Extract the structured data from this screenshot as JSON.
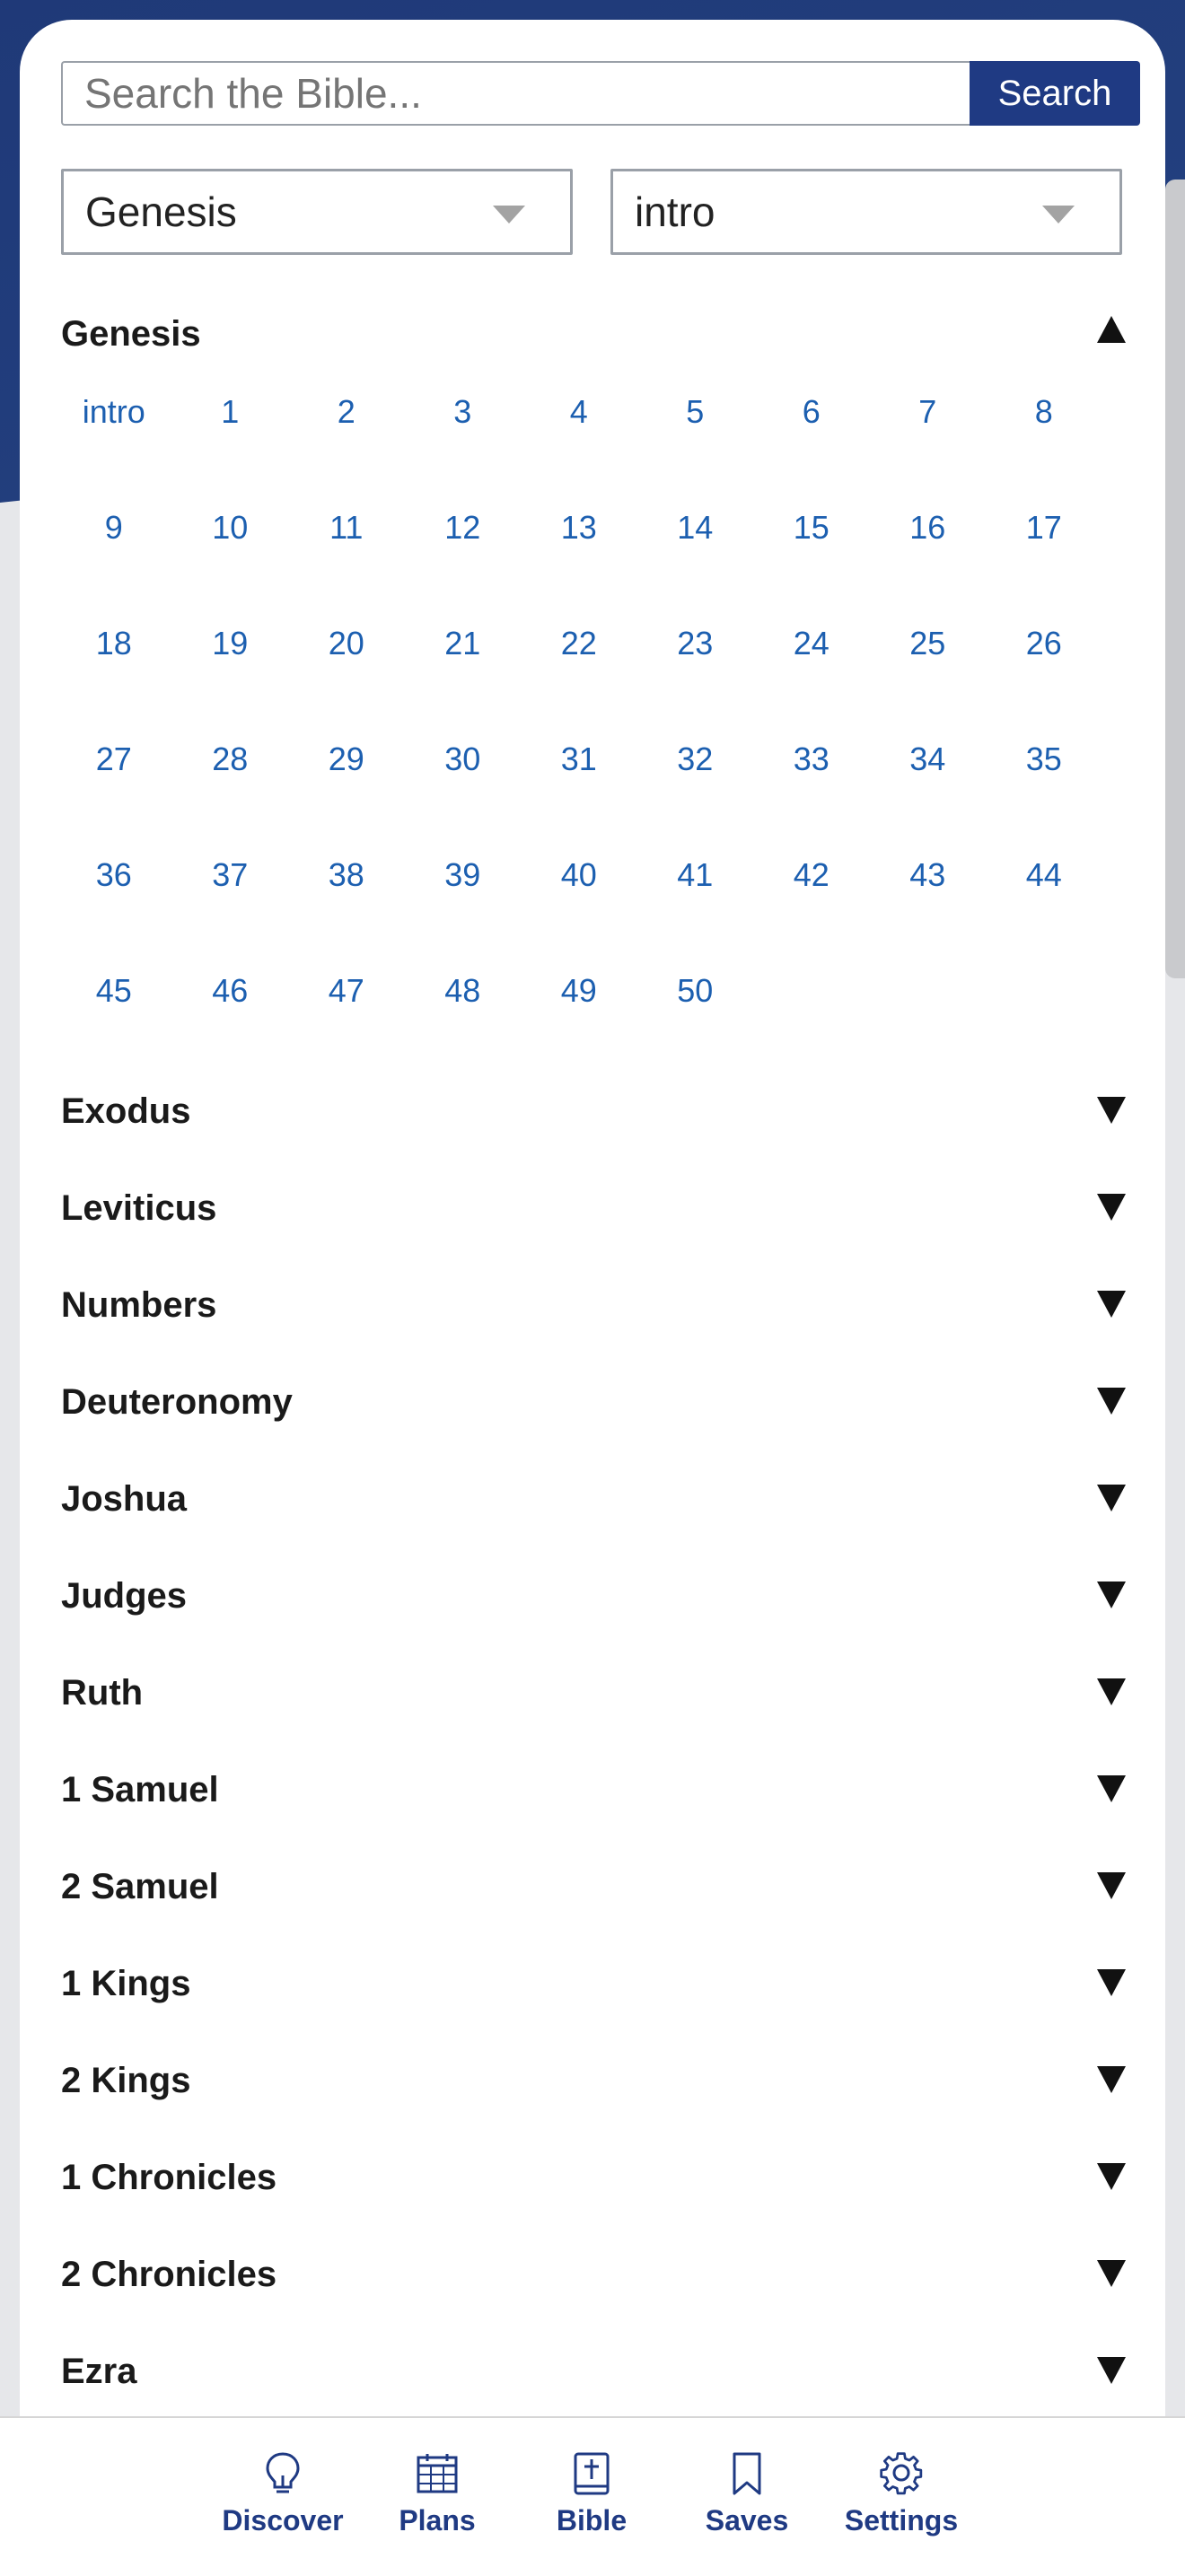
{
  "search": {
    "placeholder": "Search the Bible...",
    "button_label": "Search"
  },
  "selectors": {
    "book": "Genesis",
    "chapter": "intro"
  },
  "expanded_book": {
    "name": "Genesis",
    "chapters": [
      "intro",
      "1",
      "2",
      "3",
      "4",
      "5",
      "6",
      "7",
      "8",
      "9",
      "10",
      "11",
      "12",
      "13",
      "14",
      "15",
      "16",
      "17",
      "18",
      "19",
      "20",
      "21",
      "22",
      "23",
      "24",
      "25",
      "26",
      "27",
      "28",
      "29",
      "30",
      "31",
      "32",
      "33",
      "34",
      "35",
      "36",
      "37",
      "38",
      "39",
      "40",
      "41",
      "42",
      "43",
      "44",
      "45",
      "46",
      "47",
      "48",
      "49",
      "50"
    ]
  },
  "books": [
    "Exodus",
    "Leviticus",
    "Numbers",
    "Deuteronomy",
    "Joshua",
    "Judges",
    "Ruth",
    "1 Samuel",
    "2 Samuel",
    "1 Kings",
    "2 Kings",
    "1 Chronicles",
    "2 Chronicles",
    "Ezra"
  ],
  "tabbar": {
    "items": [
      {
        "label": "Discover",
        "icon": "lightbulb-icon"
      },
      {
        "label": "Plans",
        "icon": "calendar-icon"
      },
      {
        "label": "Bible",
        "icon": "bible-icon"
      },
      {
        "label": "Saves",
        "icon": "bookmark-icon"
      },
      {
        "label": "Settings",
        "icon": "gear-icon"
      }
    ]
  },
  "colors": {
    "brand": "#1f3a83",
    "link": "#1c5fb0",
    "background": "#23407f"
  }
}
